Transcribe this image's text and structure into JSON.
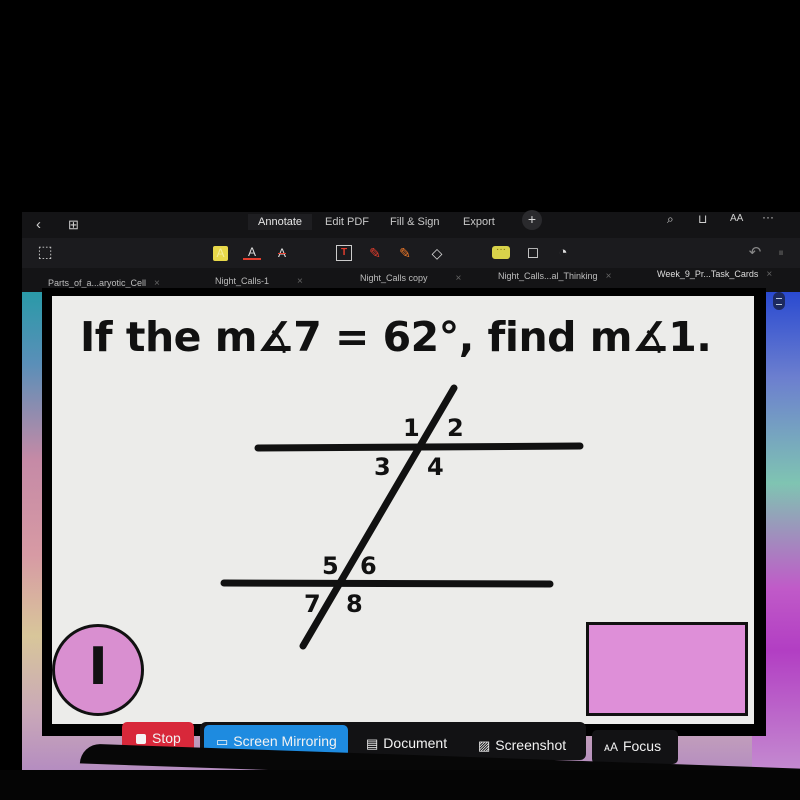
{
  "menubar": {
    "tabs": [
      {
        "label": "Annotate",
        "active": true
      },
      {
        "label": "Edit PDF",
        "active": false
      },
      {
        "label": "Fill & Sign",
        "active": false
      },
      {
        "label": "Export",
        "active": false
      }
    ],
    "plus_label": "+",
    "back_icon": "‹",
    "grid_icon": "⊞",
    "right_icons": {
      "search": "⌕",
      "book": "⊔",
      "text_size": "AA",
      "more": "···"
    }
  },
  "toolbar": {
    "select_icon": "⬚",
    "highlight_label": "A",
    "underline_label": "A",
    "strike_label": "A",
    "textbox_label": "T",
    "pen_icon": "✎",
    "marker_icon": "✎",
    "eraser_icon": "◇",
    "comment_icon": "···",
    "shape_icon": "◻",
    "sticker_icon": "◔",
    "undo_icon": "↶",
    "redo_icon": "⏸",
    "highlight_color": "#e8d84a",
    "accent_red": "#e53e2e"
  },
  "doc_tabs": [
    {
      "label": "Parts_of_a...aryotic_Cell"
    },
    {
      "label": "Night_Calls-1"
    },
    {
      "label": "Night_Calls copy"
    },
    {
      "label": "Night_Calls...al_Thinking"
    },
    {
      "label": "Week_9_Pr...Task_Cards"
    }
  ],
  "tab_close": "×",
  "slide": {
    "question": "If the m∡7 = 62°, find m∡1.",
    "angle_labels": [
      "1",
      "2",
      "3",
      "4",
      "5",
      "6",
      "7",
      "8"
    ],
    "answer_letter": "I",
    "answer_circle_color": "#d98fd0",
    "answer_box_color": "#de8fd8"
  },
  "controls": {
    "stop": "Stop",
    "screen_mirroring": "Screen Mirroring",
    "document": "Document",
    "screenshot": "Screenshot",
    "focus": "Focus",
    "focus_icon": "ᴀA",
    "mirror_icon": "▭",
    "document_icon": "▤",
    "screenshot_icon": "▨",
    "stop_color": "#d8283a",
    "mirror_color": "#1e8be0"
  }
}
